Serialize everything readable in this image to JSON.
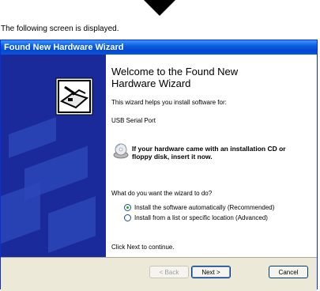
{
  "caption": "The following screen is displayed.",
  "window": {
    "title": "Found New Hardware Wizard"
  },
  "wizard": {
    "heading": "Welcome to the Found New Hardware Wizard",
    "intro": "This wizard helps you install software for:",
    "device": "USB Serial Port",
    "cd_message": "If your hardware came with an installation CD or floppy disk, insert it now.",
    "question": "What do you want the wizard to do?",
    "options": [
      {
        "label": "Install the software automatically (Recommended)",
        "selected": true
      },
      {
        "label": "Install from a list or specific location (Advanced)",
        "selected": false
      }
    ],
    "footer": "Click Next to continue."
  },
  "buttons": {
    "back": "< Back",
    "next": "Next >",
    "cancel": "Cancel"
  }
}
